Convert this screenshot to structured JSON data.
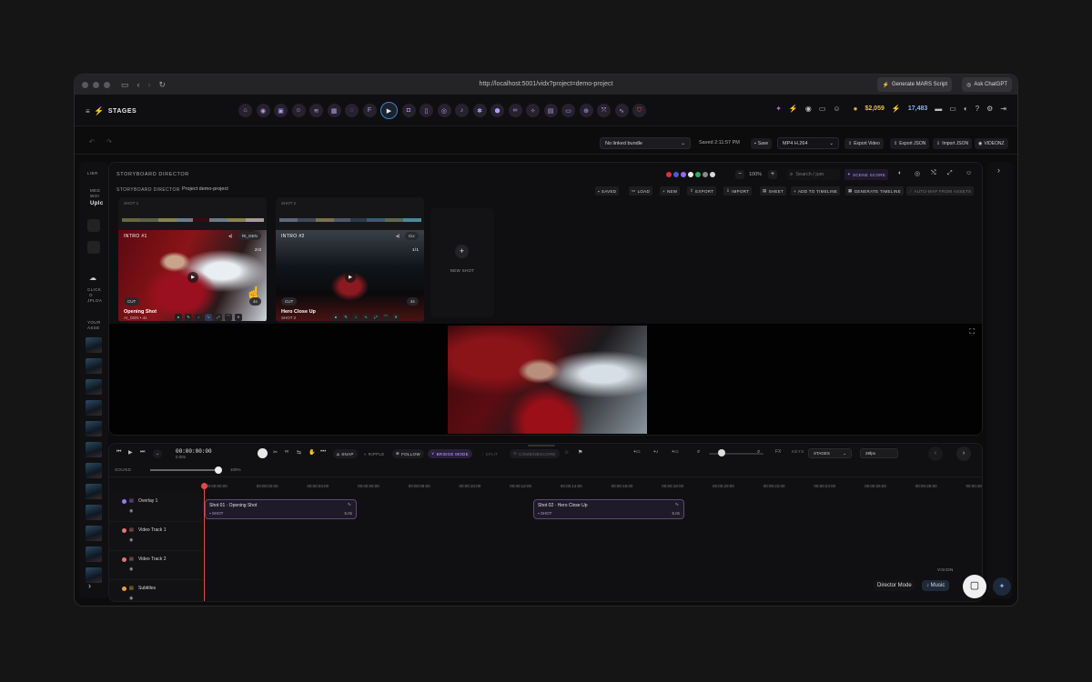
{
  "browser": {
    "url": "http://localhost:5001/vidx?project=demo-project",
    "ext_button_1": "Generate MARS Script",
    "ext_button_2": "Ask ChatGPT"
  },
  "app": {
    "brand": "STAGES",
    "credits_1": "$2,059",
    "credits_2": "17,483"
  },
  "toolbar": {
    "bundle_select": "No linked bundle",
    "saved_status": "Saved 2:11:57 PM",
    "save_label": "Save",
    "format_select": "MP4 H.264",
    "export_video": "Export Video",
    "export_json": "Export JSON",
    "import_json": "Import JSON",
    "videonz": "VIDEONZ"
  },
  "library": {
    "title": "LIBR",
    "media_1": "MED",
    "media_2": "WOI",
    "upload": "Uplc",
    "click": "CLICK",
    "o": "O",
    "upload2": "JPLOA",
    "your": "YOUR",
    "assets": "ASSE"
  },
  "storyboard": {
    "title": "STORYBOARD DIRECTOR",
    "zoom": "100%",
    "search_placeholder": "Search / jum",
    "scene_score": "SCENE SCORE",
    "sub_label": "STORYBOARD DIRECTOR",
    "project": "Project demo-project",
    "colors": [
      "#e0303a",
      "#4a5ad8",
      "#9a6ae8",
      "#e8e8e8",
      "#3aa860",
      "#8a8a8a",
      "#d8d8d8"
    ],
    "actions": [
      "SAVED",
      "LOAD",
      "NEW",
      "EXPORT",
      "IMPORT",
      "SHEET",
      "ADD TO TIMELINE",
      "GENERATE TIMELINE",
      "AUTO-MAP FROM ASSETS"
    ]
  },
  "shots": [
    {
      "tag": "INTRO #1",
      "ref": "RI_GEN",
      "count": "2/2",
      "cut": "CUT",
      "dur": "4s",
      "name": "Opening Shot",
      "sub": "AI_GEN • 4s",
      "shot_top": "SHOT 1"
    },
    {
      "tag": "INTRO #2",
      "ref": "CU",
      "count": "1/1",
      "cut": "CUT",
      "dur": "4s",
      "name": "Hero Close Up",
      "sub": "SHOT 2",
      "shot_top": "SHOT 2"
    }
  ],
  "new_shot": "NEW SHOT",
  "timeline": {
    "timecode": "00:00:00:00",
    "timecode_sub": "0.00s",
    "snap": "SNAP",
    "ripple": "RIPPLE",
    "follow": "FOLLOW",
    "bridge": "BRIDGE MODE",
    "split": "SPLIT",
    "combine": "COMBINESCORE",
    "fx": "FX",
    "keys": "KEYS",
    "keys_select": "STAGES",
    "fps": "29fps",
    "sound": "SOUND",
    "volume": "100%",
    "volume_level": 1.0,
    "ruler": [
      "00:00:00:00",
      "00:00:02:00",
      "00:00:04:00",
      "00:00:06:00",
      "00:00:08:00",
      "00:00:10:00",
      "00:00:12:00",
      "00:00:14:00",
      "00:00:16:00",
      "00:00:18:00",
      "00:00:20:00",
      "00:00:22:00",
      "00:00:24:00",
      "00:00:26:00",
      "00:00:28:00",
      "00:00:30"
    ],
    "tracks": [
      {
        "name": "Overlay 1",
        "color": "#9a7ae8"
      },
      {
        "name": "Video Track 1",
        "color": "#e07878"
      },
      {
        "name": "Video Track 2",
        "color": "#e07878"
      },
      {
        "name": "Subtitles",
        "color": "#e8a040"
      }
    ],
    "clips": [
      {
        "title": "Shot 01 · Opening Shot",
        "type": "SHOT",
        "dur": "5.0s"
      },
      {
        "title": "Shot 02 · Hero Close Up",
        "type": "SHOT",
        "dur": "5.0s"
      }
    ]
  },
  "footer": {
    "vision": "VISION",
    "director_mode": "Director Mode",
    "music": "Music"
  }
}
